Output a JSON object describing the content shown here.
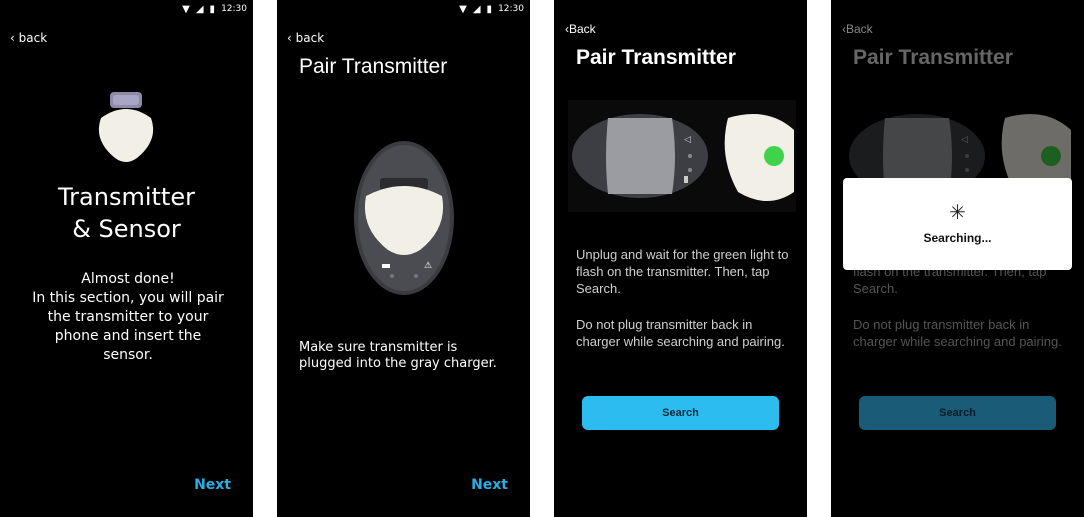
{
  "status": {
    "time": "12:30"
  },
  "screens": [
    {
      "back": "back",
      "heading_line1": "Transmitter",
      "heading_line2": "& Sensor",
      "body": "Almost done!\nIn this section, you will pair the transmitter to your phone and insert the sensor.",
      "next": "Next"
    },
    {
      "back": "back",
      "title": "Pair Transmitter",
      "instruction": "Make sure transmitter is plugged into the gray charger.",
      "next": "Next"
    },
    {
      "back": "Back",
      "title": "Pair Transmitter",
      "para1": "Unplug and wait for the green light to flash on the transmitter. Then, tap Search.",
      "para2": "Do not plug transmitter back in charger while searching and pairing.",
      "search": "Search"
    },
    {
      "back": "Back",
      "title": "Pair Transmitter",
      "para1": "Unplug and wait for the green light to flash on the transmitter. Then, tap Search.",
      "para2": "Do not plug transmitter back in charger while searching and pairing.",
      "search": "Search",
      "dialog": "Searching..."
    }
  ],
  "icons": {
    "wifi": "wifi-icon",
    "signal": "signal-icon",
    "battery": "battery-icon",
    "spinner": "spinner-icon",
    "transmitter": "transmitter-icon",
    "charger": "charger-icon"
  },
  "colors": {
    "accent": "#29aee6",
    "search_button": "#2dbcef",
    "led_green": "#3fd24a"
  }
}
